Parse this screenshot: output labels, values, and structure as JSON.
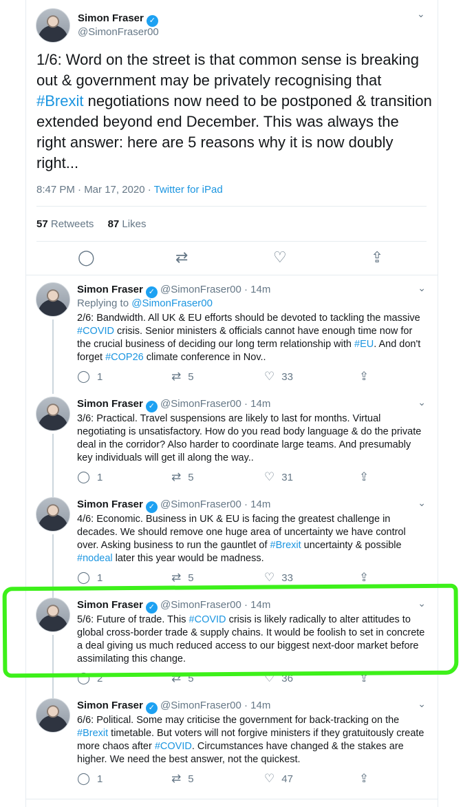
{
  "main_tweet": {
    "name": "Simon Fraser",
    "handle": "@SimonFraser00",
    "text_before": "1/6: Word on the street is that common sense is breaking out & government may be privately recognising that ",
    "hashtag": "#Brexit",
    "text_after": " negotiations now need to be postponed & transition extended beyond end December. This was always the right answer: here are 5 reasons why it is now doubly right...",
    "timestamp": "8:47 PM · Mar 17, 2020 · ",
    "source": "Twitter for iPad",
    "retweets_count": "57",
    "retweets_label": "Retweets",
    "likes_count": "87",
    "likes_label": "Likes"
  },
  "replies": [
    {
      "name": "Simon Fraser",
      "handle": "@SimonFraser00",
      "time": "14m",
      "replying_to_prefix": "Replying to ",
      "replying_to": "@SimonFraser00",
      "segments": [
        "2/6: Bandwidth. All UK & EU efforts should be devoted to tackling the massive ",
        "#COVID",
        " crisis. Senior ministers & officials cannot have enough time now for the crucial business of deciding our long term relationship with ",
        "#EU",
        ". And don't forget ",
        "#COP26",
        " climate conference in Nov.."
      ],
      "replies": "1",
      "retweets": "5",
      "likes": "33"
    },
    {
      "name": "Simon Fraser",
      "handle": "@SimonFraser00",
      "time": "14m",
      "text": "3/6: Practical. Travel suspensions are likely to last for months. Virtual negotiating is unsatisfactory. How do you read body language & do the private deal in the corridor? Also harder to coordinate large teams. And presumably key individuals will get ill along the way..",
      "replies": "1",
      "retweets": "5",
      "likes": "31"
    },
    {
      "name": "Simon Fraser",
      "handle": "@SimonFraser00",
      "time": "14m",
      "segments": [
        "4/6: Economic. Business in UK & EU is facing the greatest challenge in decades. We should remove one huge area of uncertainty we have control over. Asking business to run the gauntlet of ",
        "#Brexit",
        " uncertainty & possible ",
        "#nodeal",
        " later this year would be madness."
      ],
      "replies": "1",
      "retweets": "5",
      "likes": "33"
    },
    {
      "name": "Simon Fraser",
      "handle": "@SimonFraser00",
      "time": "14m",
      "segments": [
        "5/6: Future of trade. This ",
        "#COVID",
        " crisis is likely radically to alter attitudes to global cross-border trade & supply chains. It would be foolish to set in concrete a deal giving us much reduced access to our biggest next-door market before assimilating this change."
      ],
      "replies": "2",
      "retweets": "5",
      "likes": "36"
    },
    {
      "name": "Simon Fraser",
      "handle": "@SimonFraser00",
      "time": "14m",
      "segments": [
        "6/6: Political. Some may criticise the government for back-tracking on the ",
        "#Brexit",
        " timetable. But voters will not forgive ministers if they gratuitously create more chaos after ",
        "#COVID",
        ". Circumstances have changed & the stakes are higher. We need the best answer, not the quickest."
      ],
      "replies": "1",
      "retweets": "5",
      "likes": "47"
    }
  ],
  "icons": {
    "verified": "✓",
    "chevron": "⌄",
    "reply": "◯",
    "retweet": "⇄",
    "like": "♡",
    "share": "⇪"
  },
  "colors": {
    "link": "#1b95e0",
    "muted": "#657786",
    "verified": "#1da1f2",
    "highlight": "#3df01a"
  }
}
